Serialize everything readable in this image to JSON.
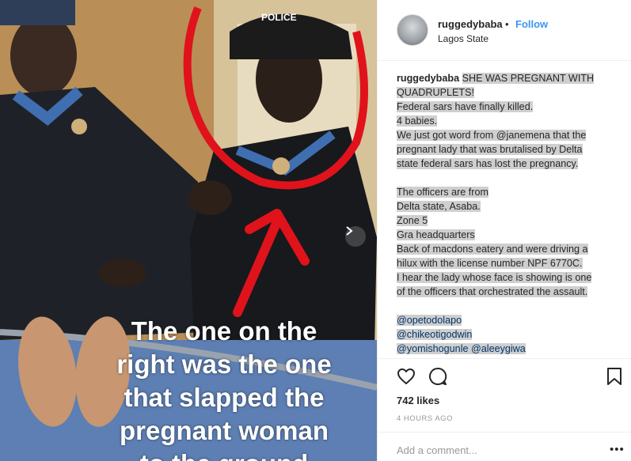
{
  "post": {
    "overlay_lines": [
      "The one on the",
      "right was the one",
      "that slapped the",
      "pregnant woman",
      "to the ground"
    ],
    "police_cap_text": "POLICE"
  },
  "header": {
    "username": "ruggedybaba",
    "separator": "•",
    "follow_label": "Follow",
    "location": "Lagos State"
  },
  "caption": {
    "username": "ruggedybaba",
    "lines": [
      "SHE WAS PREGNANT WITH",
      "QUADRUPLETS!",
      "Federal sars have finally killed.",
      "4 babies.",
      "We just got word from @janemena that the",
      "pregnant lady that was brutalised by Delta",
      "state federal sars has lost the pregnancy.",
      "",
      "The officers are from",
      "Delta state, Asaba.",
      "Zone 5",
      "Gra headquarters",
      "Back of macdons eatery and were driving a",
      "hilux with the license number NPF 6770C.",
      "I hear the lady whose face is showing is one",
      "of the officers that orchestrated the assault."
    ],
    "mentions": [
      "@opetodolapo",
      "@chikeotigodwin",
      "@yomishogunle @aleeygiwa"
    ]
  },
  "actions": {
    "like_icon": "heart-icon",
    "comment_icon": "comment-icon",
    "save_icon": "bookmark-icon"
  },
  "likes": "742 likes",
  "timestamp": "4 HOURS AGO",
  "comment_placeholder": "Add a comment...",
  "more_label": "•••"
}
